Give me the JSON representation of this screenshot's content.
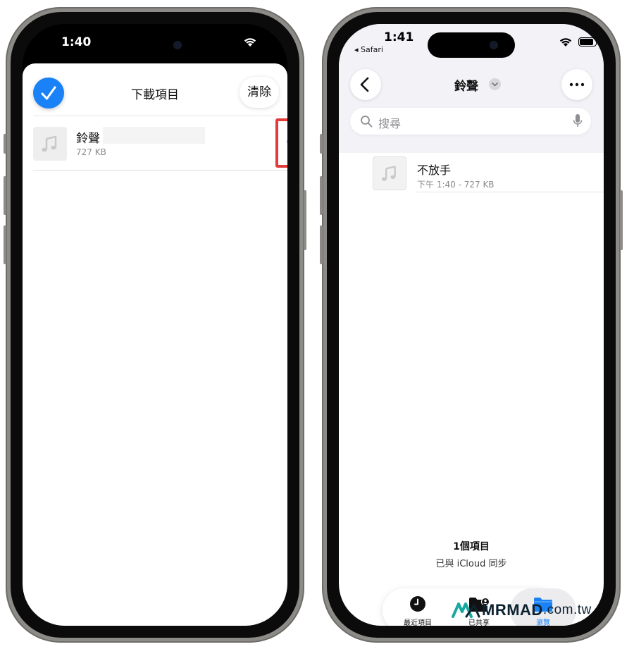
{
  "left_screen": {
    "status_time": "1:40",
    "sheet_title": "下載項目",
    "clear_button": "清除",
    "download_item": {
      "name": "鈴聲",
      "size": "727 KB"
    },
    "icons": {
      "done": "checkmark-icon",
      "file": "music-note-icon",
      "reveal": "magnifying-glass-icon",
      "wifi": "wifi-icon",
      "highlight_color": "#e23b3b"
    }
  },
  "right_screen": {
    "status_time": "1:41",
    "back_app": "◂ Safari",
    "folder_title": "鈴聲",
    "search_placeholder": "搜尋",
    "file": {
      "name": "不放手",
      "meta": "下午 1:40 - 727 KB"
    },
    "footer": {
      "item_count": "1個項目",
      "sync_status": "已與 iCloud 同步"
    },
    "tabs": [
      {
        "label": "最近項目",
        "icon": "clock-icon"
      },
      {
        "label": "已共享",
        "icon": "shared-folder-icon"
      },
      {
        "label": "瀏覽",
        "icon": "folder-icon",
        "active": true
      }
    ],
    "accent_color": "#1a82f6"
  },
  "watermark": {
    "brand": "MRMAD",
    "tld": ".com.tw"
  }
}
